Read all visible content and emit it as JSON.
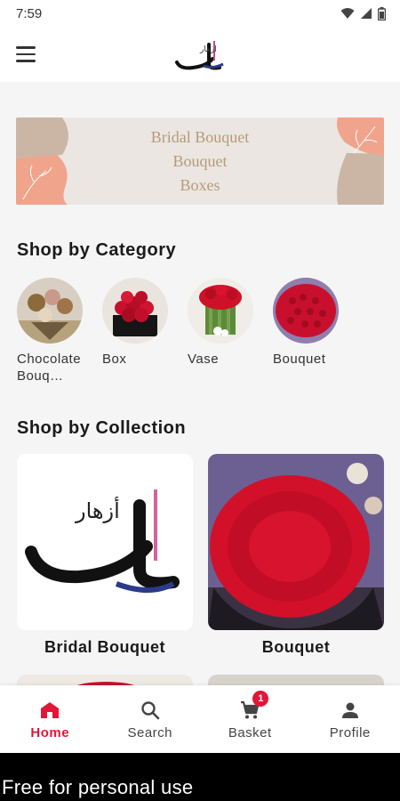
{
  "status_bar": {
    "time": "7:59",
    "icons": [
      "wifi-icon",
      "signal-icon",
      "battery-icon"
    ]
  },
  "app_bar": {
    "menu_icon": "hamburger-icon",
    "logo_icon": "ashar-logo-icon"
  },
  "banner": {
    "lines": [
      "Bridal Bouquet",
      "Bouquet",
      "Boxes"
    ]
  },
  "sections": {
    "category_title": "Shop by Category",
    "collection_title": "Shop by Collection"
  },
  "categories": [
    {
      "label": "Chocolate Bouq…",
      "image": "chocolate-bouquet-image"
    },
    {
      "label": "Box",
      "image": "rose-box-image"
    },
    {
      "label": "Vase",
      "image": "rose-vase-image"
    },
    {
      "label": "Bouquet",
      "image": "rose-bouquet-image"
    }
  ],
  "collections": [
    {
      "label": "Bridal Bouquet",
      "image": "ashar-logo-image",
      "logo_text": "أزهار"
    },
    {
      "label": "Bouquet",
      "image": "large-rose-bouquet-image"
    }
  ],
  "bottom_nav": {
    "items": [
      {
        "label": "Home",
        "icon": "home-icon",
        "active": true
      },
      {
        "label": "Search",
        "icon": "search-icon",
        "active": false
      },
      {
        "label": "Basket",
        "icon": "cart-icon",
        "active": false,
        "badge": "1"
      },
      {
        "label": "Profile",
        "icon": "person-icon",
        "active": false
      }
    ]
  },
  "footer": {
    "watermark": "Free for personal use"
  },
  "colors": {
    "accent": "#e01737",
    "banner_bg": "#ebe6e2",
    "banner_text": "#b69a76",
    "peach": "#f0a48c",
    "taupe": "#cbb6a6"
  }
}
